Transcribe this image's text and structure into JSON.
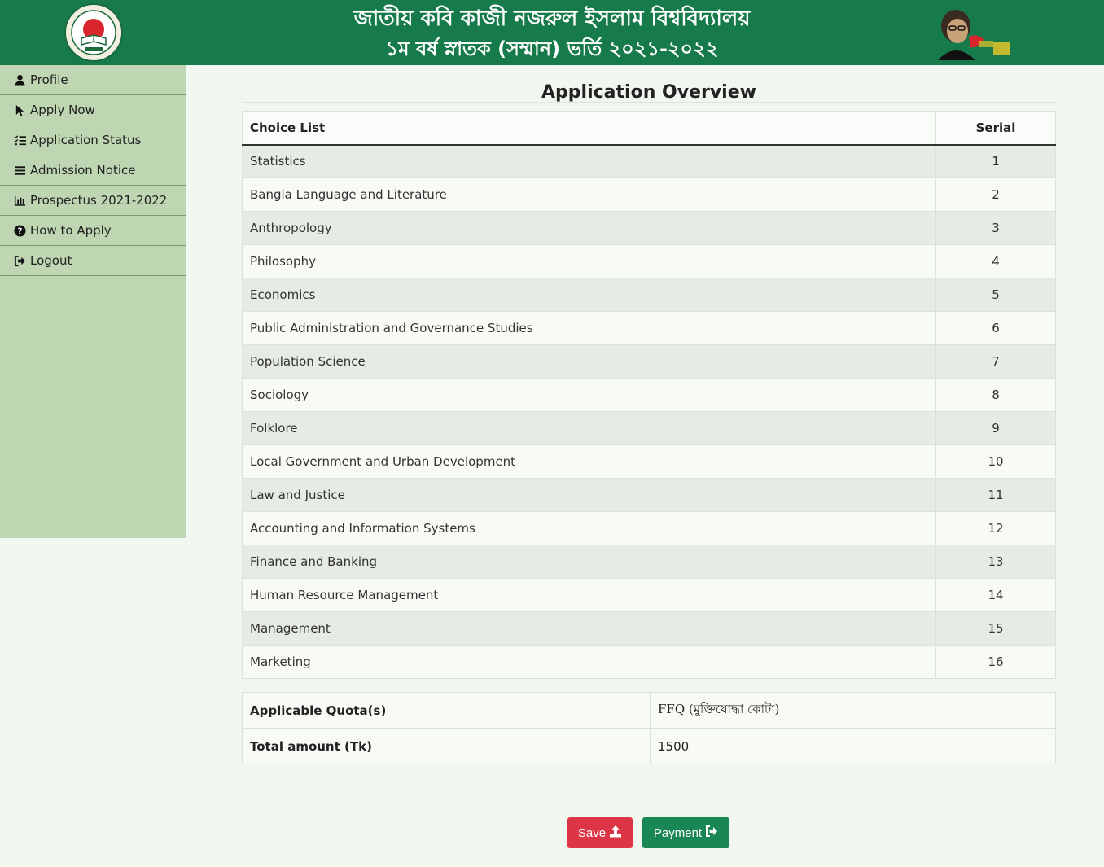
{
  "header": {
    "title": "জাতীয় কবি কাজী নজরুল ইসলাম বিশ্ববিদ্যালয়",
    "subtitle": "১ম বর্ষ স্নাতক (সম্মান) ভর্তি ২০২১-২০২২",
    "left_logo_icon": "university-seal-icon",
    "right_logo_icon": "mujib-100-logo-icon"
  },
  "sidebar": {
    "items": [
      {
        "label": "Profile",
        "icon": "user-icon"
      },
      {
        "label": "Apply Now",
        "icon": "pointer-icon"
      },
      {
        "label": "Application Status",
        "icon": "list-check-icon"
      },
      {
        "label": "Admission Notice",
        "icon": "menu-icon"
      },
      {
        "label": "Prospectus 2021-2022",
        "icon": "bar-chart-icon"
      },
      {
        "label": "How to Apply",
        "icon": "question-circle-icon"
      },
      {
        "label": "Logout",
        "icon": "logout-icon"
      }
    ]
  },
  "main": {
    "title": "Application Overview",
    "choice_table": {
      "headers": [
        "Choice List",
        "Serial"
      ],
      "rows": [
        {
          "subject": "Statistics",
          "serial": "1"
        },
        {
          "subject": "Bangla Language and Literature",
          "serial": "2"
        },
        {
          "subject": "Anthropology",
          "serial": "3"
        },
        {
          "subject": "Philosophy",
          "serial": "4"
        },
        {
          "subject": "Economics",
          "serial": "5"
        },
        {
          "subject": "Public Administration and Governance Studies",
          "serial": "6"
        },
        {
          "subject": "Population Science",
          "serial": "7"
        },
        {
          "subject": "Sociology",
          "serial": "8"
        },
        {
          "subject": "Folklore",
          "serial": "9"
        },
        {
          "subject": "Local Government and Urban Development",
          "serial": "10"
        },
        {
          "subject": "Law and Justice",
          "serial": "11"
        },
        {
          "subject": "Accounting and Information Systems",
          "serial": "12"
        },
        {
          "subject": "Finance and Banking",
          "serial": "13"
        },
        {
          "subject": "Human Resource Management",
          "serial": "14"
        },
        {
          "subject": "Management",
          "serial": "15"
        },
        {
          "subject": "Marketing",
          "serial": "16"
        }
      ]
    },
    "info": {
      "quota_label": "Applicable Quota(s)",
      "quota_value": "FFQ (মুক্তিযোদ্ধা কোটা)",
      "amount_label": "Total amount (Tk)",
      "amount_value": "1500"
    }
  },
  "buttons": {
    "save_label": "Save",
    "save_icon": "upload-icon",
    "payment_label": "Payment",
    "payment_icon": "sign-out-icon"
  },
  "colors": {
    "header": "#167a4b",
    "sidebar": "#bed6b2",
    "background": "#f1f6ef",
    "save": "#dc3545",
    "payment": "#198754"
  }
}
